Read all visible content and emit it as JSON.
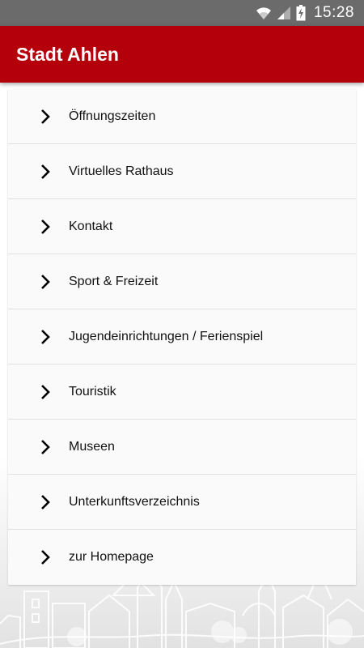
{
  "status_bar": {
    "time": "15:28",
    "icons": [
      "wifi-icon",
      "signal-icon",
      "battery-charging-icon"
    ]
  },
  "app_bar": {
    "title": "Stadt Ahlen"
  },
  "colors": {
    "app_bar": "#b3000b",
    "status_bar": "#6b6b6b",
    "card_background": "#fafafa"
  },
  "menu": {
    "items": [
      {
        "label": "Öffnungszeiten",
        "icon": "chevron-right-icon"
      },
      {
        "label": "Virtuelles Rathaus",
        "icon": "chevron-right-icon"
      },
      {
        "label": "Kontakt",
        "icon": "chevron-right-icon"
      },
      {
        "label": "Sport & Freizeit",
        "icon": "chevron-right-icon"
      },
      {
        "label": "Jugendeinrichtungen / Ferienspiel",
        "icon": "chevron-right-icon"
      },
      {
        "label": "Touristik",
        "icon": "chevron-right-icon"
      },
      {
        "label": "Museen",
        "icon": "chevron-right-icon"
      },
      {
        "label": "Unterkunftsverzeichnis",
        "icon": "chevron-right-icon"
      },
      {
        "label": "zur Homepage",
        "icon": "chevron-right-icon"
      }
    ]
  }
}
